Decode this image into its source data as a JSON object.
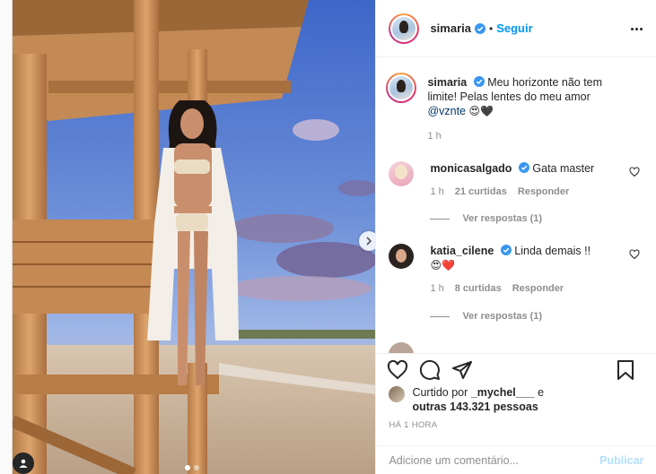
{
  "post": {
    "author": {
      "username": "simaria",
      "verified_icon": "verified-badge-icon",
      "follow_label": "Seguir",
      "separator": "•"
    },
    "media": {
      "carousel_dots": 2,
      "active_dot": 0,
      "next_icon": "chevron-right-icon",
      "tag_icon": "user-tag-icon"
    },
    "caption": {
      "username": "simaria",
      "text_before_mention": "Meu horizonte não tem limite! Pelas lentes do meu amor ",
      "mention": "@vznte",
      "emojis": "😍🖤",
      "time": "1 h"
    },
    "comments": [
      {
        "username": "monicasalgado",
        "verified": true,
        "text": "Gata master",
        "time": "1 h",
        "likes": "21 curtidas",
        "reply_label": "Responder",
        "view_replies": "Ver respostas (1)"
      },
      {
        "username": "katia_cilene",
        "verified": true,
        "text": "Linda demais !!",
        "emojis": "😍❤️",
        "time": "1 h",
        "likes": "8 curtidas",
        "reply_label": "Responder",
        "view_replies": "Ver respostas (1)"
      }
    ],
    "likes_summary": {
      "prefix": "Curtido por ",
      "user": "_mychel___",
      "middle": " e ",
      "others": "outras 143.321 pessoas"
    },
    "timestamp": "HÁ 1 HORA",
    "add_comment": {
      "placeholder": "Adicione um comentário...",
      "publish_label": "Publicar"
    },
    "colors": {
      "accent": "#0095f6",
      "publish_disabled": "#b2dffc",
      "muted": "#8e8e8e",
      "heart_red": "#ed4956"
    }
  }
}
